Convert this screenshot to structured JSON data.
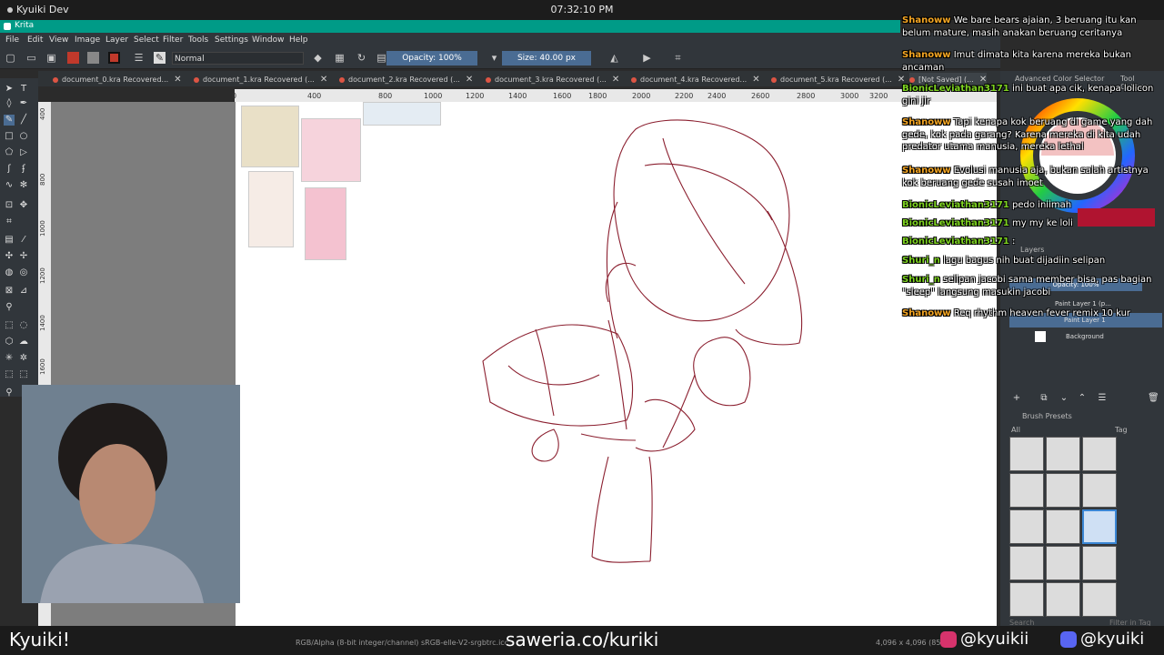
{
  "system_bar": {
    "title": "Kyuiki Dev",
    "clock": "07:32:10 PM"
  },
  "window": {
    "title": "Krita"
  },
  "menu": [
    "File",
    "Edit",
    "View",
    "Image",
    "Layer",
    "Select",
    "Filter",
    "Tools",
    "Settings",
    "Window",
    "Help"
  ],
  "toolbar": {
    "blend_mode": "Normal",
    "opacity": "Opacity: 100%",
    "size": "Size: 40.00 px"
  },
  "tabs": [
    "document_0.kra Recovered...",
    "document_1.kra Recovered (...",
    "document_2.kra Recovered (...",
    "document_3.kra Recovered (...",
    "document_4.kra Recovered...",
    "document_5.kra Recovered (...",
    "[Not Saved] (..."
  ],
  "ruler_ticks": [
    "0",
    "400",
    "800",
    "1000",
    "1200",
    "1400",
    "1600",
    "1800",
    "2000",
    "2200",
    "2400",
    "2600",
    "2800",
    "3000",
    "3200"
  ],
  "vruler_ticks": [
    "400",
    "800",
    "1000",
    "1200",
    "1400",
    "1600",
    "1800"
  ],
  "dockers": {
    "color_tabs": [
      "Advanced Color Selector",
      "Tool Options"
    ],
    "layers_title": "Layers",
    "opacity": "Opacity: 100%",
    "layers": [
      "Paint Layer 1 (p...",
      "Paint Layer 1",
      "Background"
    ],
    "brush_presets_title": "Brush Presets",
    "filter_all": "All",
    "tag_label": "Tag",
    "filter_in_tag": "Filter in Tag",
    "search": "Search"
  },
  "chat": [
    {
      "user": "Shanoww",
      "color": "#f5a623",
      "text": "We bare bears ajaian, 3 beruang itu kan belum mature, masih anakan beruang ceritanya"
    },
    {
      "user": "Shanoww",
      "color": "#f5a623",
      "text": "Imut dimata kita karena mereka bukan ancaman"
    },
    {
      "user": "BionicLeviathan3171",
      "color": "#7ed321",
      "text": "ini buat apa cik, kenapa lolicon gini jir"
    },
    {
      "user": "Shanoww",
      "color": "#f5a623",
      "text": "Tapi kenapa kok beruang di game yang dah gede, kok pada garang? Karena mereka di kita udah predator utama manusia, mereka lethal"
    },
    {
      "user": "Shanoww",
      "color": "#f5a623",
      "text": "Evolusi manusia aja, bukan salah artistnya kok beruang gede susah imoet"
    },
    {
      "user": "BionicLeviathan3171",
      "color": "#7ed321",
      "text": "pedo iniimah"
    },
    {
      "user": "BionicLeviathan3171",
      "color": "#7ed321",
      "text": "my my ke loli"
    },
    {
      "user": "BionicLeviathan3171",
      "color": "#7ed321",
      "text": ":"
    },
    {
      "user": "Shuri_n",
      "color": "#7ed321",
      "text": "lagu bagus nih buat dijadiin selipan"
    },
    {
      "user": "Shuri_n",
      "color": "#7ed321",
      "text": "selipan jacobi sama member bisa, pas bagian \"sleep\" langsung masukin jacobi"
    },
    {
      "user": "Shanoww",
      "color": "#f5a623",
      "text": "Req rhythm heaven fever remix 10 kur"
    }
  ],
  "status": {
    "color_info": "RGB/Alpha (8-bit integer/channel)  sRGB-elle-V2-srgbtrc.icc",
    "dims": "4,096 x 4,096 (85..."
  },
  "overlay": {
    "name": "Kyuiki!",
    "saweria": "saweria.co/kuriki",
    "instagram": "@kyuikii",
    "discord": "@kyuiki"
  },
  "colors": {
    "accent": "#009b87",
    "selection": "#4a6c93",
    "sketch": "#8b1f2f"
  }
}
